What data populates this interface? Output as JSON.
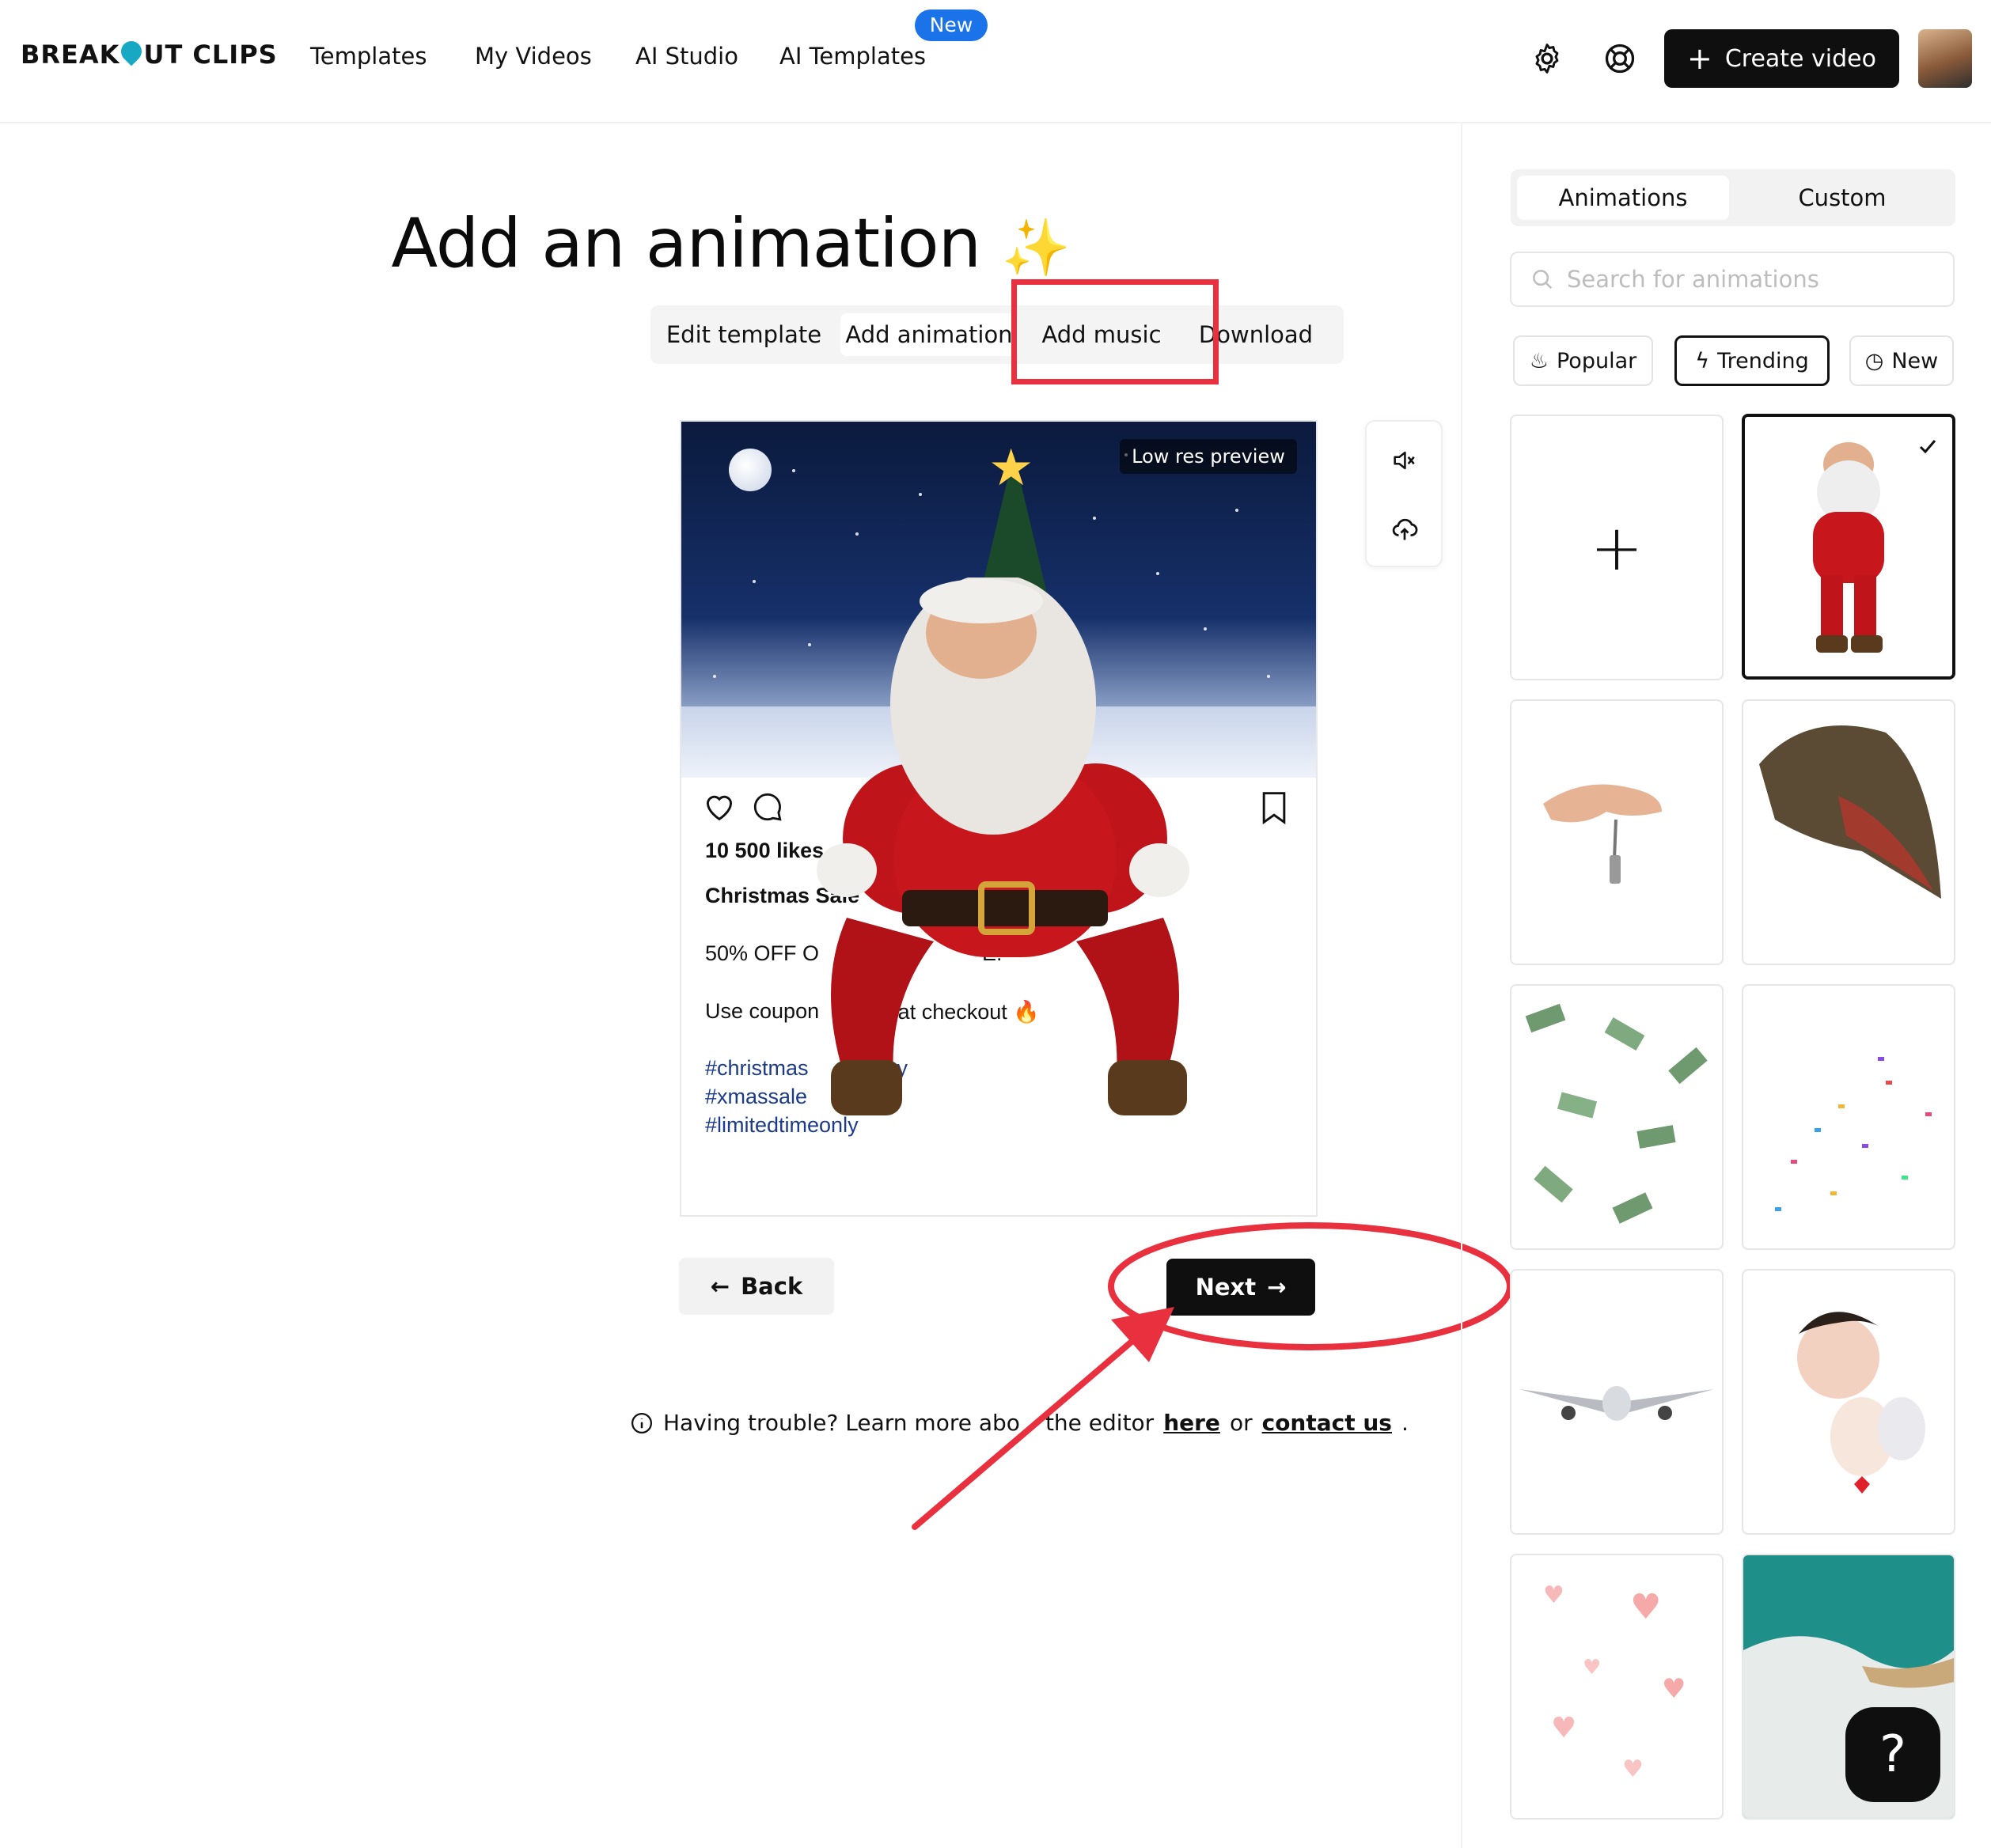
{
  "header": {
    "logo": "BREAKOUT CLIPS",
    "nav": [
      "Templates",
      "My Videos",
      "AI Studio",
      "AI Templates"
    ],
    "new_badge": "New",
    "create_label": "Create video"
  },
  "main": {
    "title": "Add an animation",
    "steps": [
      "Edit template",
      "Add animation",
      "Add music",
      "Download"
    ],
    "preview_badge": "Low res preview",
    "post": {
      "likes": "10 500 likes",
      "heading": "Christmas Sale",
      "offer": "50% OFF O",
      "offer_tail": "E!",
      "coupon": "Use coupon",
      "coupon_tail": "0' at checkout 🔥",
      "hashtags": [
        "#christmas",
        "eeasy",
        "#xmassale",
        "#limitedtimeonly"
      ]
    },
    "back_label": "Back",
    "next_label": "Next",
    "help": {
      "prefix": "Having trouble? Learn more abo",
      "middle": "the editor",
      "link1": "here",
      "or": "or",
      "link2": "contact us",
      "end": "."
    }
  },
  "panel": {
    "tabs": [
      "Animations",
      "Custom"
    ],
    "search_placeholder": "Search for animations",
    "filters": [
      "Popular",
      "Trending",
      "New"
    ],
    "selected_filter": "Trending",
    "tiles": [
      "add-animation",
      "santa",
      "hand-with-keys",
      "t-rex-head",
      "falling-money",
      "confetti",
      "airplane",
      "cupid",
      "hearts",
      "ocean-waves"
    ],
    "selected_tile": "santa"
  },
  "help_fab": "?",
  "colors": {
    "accent": "#1a73e8",
    "annotation": "#e8303f",
    "primary": "#0f0f0f"
  }
}
